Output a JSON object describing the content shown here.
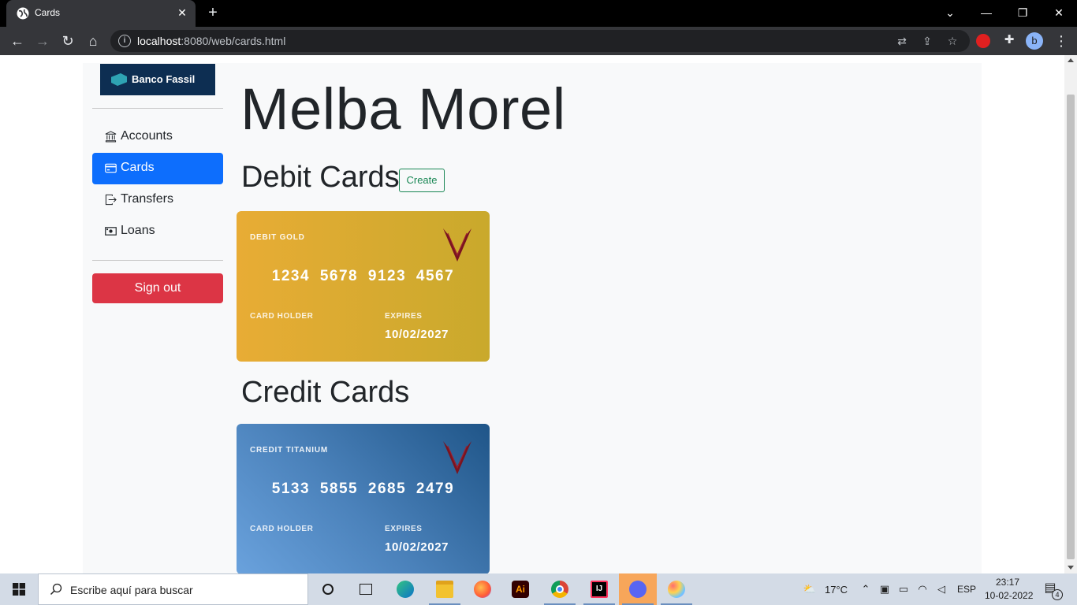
{
  "browser": {
    "tab_title": "Cards",
    "url_host": "localhost",
    "url_rest": ":8080/web/cards.html"
  },
  "sidebar": {
    "logo_text": "Banco Fassil",
    "items": [
      {
        "label": "Accounts",
        "icon": "bank-icon",
        "active": false
      },
      {
        "label": "Cards",
        "icon": "credit-card-icon",
        "active": true
      },
      {
        "label": "Transfers",
        "icon": "box-arrow-right-icon",
        "active": false
      },
      {
        "label": "Loans",
        "icon": "cash-icon",
        "active": false
      }
    ],
    "signout_label": "Sign out"
  },
  "main": {
    "client_name": "Melba Morel",
    "debit_title": "Debit Cards",
    "create_label": "Create",
    "credit_title": "Credit Cards",
    "debit_cards": [
      {
        "type": "DEBIT GOLD",
        "number": "1234 5678 9123 4567",
        "holder_label": "CARD HOLDER",
        "holder": "",
        "expires_label": "EXPIRES",
        "expires": "10/02/2027"
      }
    ],
    "credit_cards": [
      {
        "type": "CREDIT TITANIUM",
        "number": "5133 5855 2685 2479",
        "holder_label": "CARD HOLDER",
        "holder": "",
        "expires_label": "EXPIRES",
        "expires": "10/02/2027"
      }
    ]
  },
  "taskbar": {
    "search_placeholder": "Escribe aquí para buscar",
    "weather": "17°C",
    "language": "ESP",
    "time": "23:17",
    "date": "10-02-2022",
    "notification_count": "4"
  },
  "colors": {
    "primary": "#0d6efd",
    "danger": "#dc3545",
    "success": "#198754",
    "gold_card": "#e8ac35",
    "titanium_card": "#4b82bb"
  }
}
